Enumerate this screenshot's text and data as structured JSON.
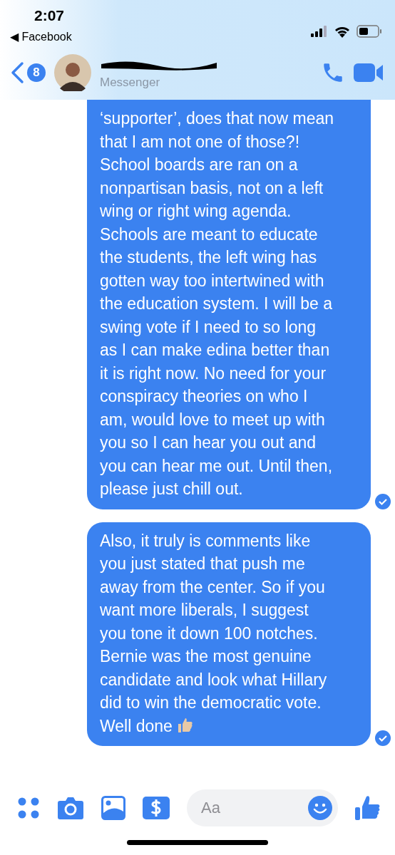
{
  "status_bar": {
    "time": "2:07",
    "back_app": "◀ Facebook"
  },
  "header": {
    "unread_count": "8",
    "subtitle": "Messenger"
  },
  "messages": [
    {
      "text": "‘supporter’, does that now mean\nthat I am not one of those?!\nSchool boards are ran on a\nnonpartisan basis, not on a left\nwing or right wing agenda.\nSchools are meant to educate\nthe students, the left wing has\ngotten way too intertwined with\nthe education system. I will be a\nswing vote if I need to so long\nas I can make edina better than\nit is right now. No need for your\nconspiracy theories on who I\nam, would love to meet up with\nyou so I can hear you out and\nyou can hear me out. Until then,\nplease just chill out.",
      "cut_top": true,
      "ends_with_thumb": false
    },
    {
      "text": "Also, it truly is comments like\nyou just stated that push me\naway from the center. So if you\nwant more liberals, I suggest\nyou tone it down 100 notches.\nBernie was the most genuine\ncandidate and look what Hillary\ndid to win the democratic vote.\nWell done",
      "cut_top": false,
      "ends_with_thumb": true
    }
  ],
  "composer": {
    "placeholder": "Aa"
  }
}
